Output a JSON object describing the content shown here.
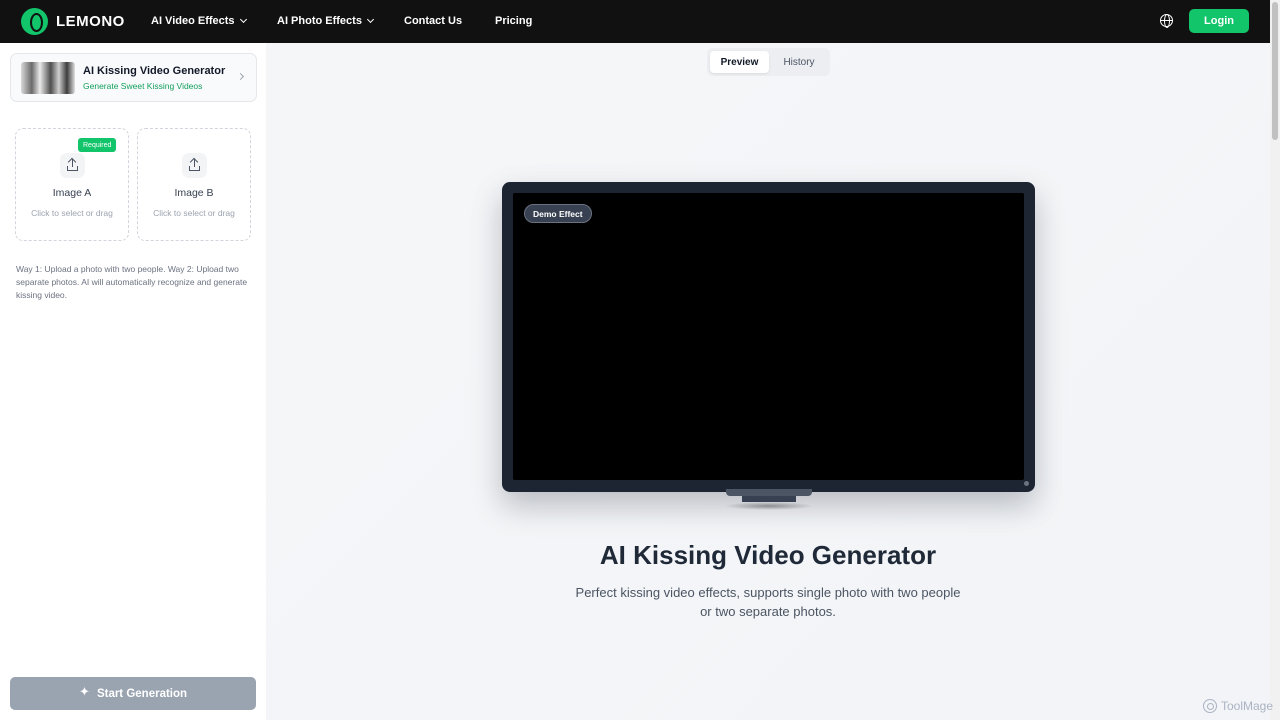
{
  "header": {
    "brand": "LEMONO",
    "nav": [
      {
        "label": "AI Video Effects",
        "has_dropdown": true
      },
      {
        "label": "AI Photo Effects",
        "has_dropdown": true
      },
      {
        "label": "Contact Us",
        "has_dropdown": false
      },
      {
        "label": "Pricing",
        "has_dropdown": false
      }
    ],
    "language_icon": "globe-icon",
    "login_label": "Login"
  },
  "sidebar": {
    "tool": {
      "title": "AI Kissing Video Generator",
      "subtitle": "Generate Sweet Kissing Videos"
    },
    "uploads": [
      {
        "title": "Image A",
        "hint": "Click to select or drag",
        "badge": "Required"
      },
      {
        "title": "Image B",
        "hint": "Click to select or drag"
      }
    ],
    "hint": "Way 1: Upload a photo with two people. Way 2: Upload two separate photos. AI will automatically recognize and generate kissing video.",
    "start_label": "Start Generation"
  },
  "main": {
    "tabs": [
      {
        "label": "Preview",
        "active": true
      },
      {
        "label": "History",
        "active": false
      }
    ],
    "demo_badge": "Demo Effect",
    "title": "AI Kissing Video Generator",
    "description": "Perfect kissing video effects, supports single photo with two people or two separate photos."
  },
  "watermark": "ToolMage",
  "colors": {
    "brand_green": "#12c46a",
    "topbar_bg": "#111111",
    "button_disabled": "#9aa4b1"
  }
}
